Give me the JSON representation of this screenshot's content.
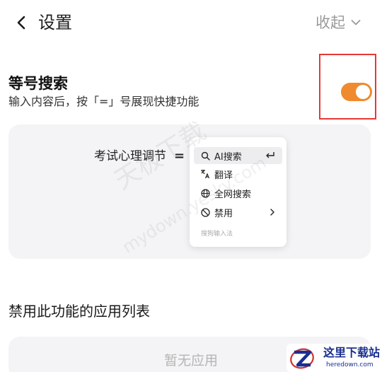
{
  "header": {
    "title": "设置",
    "collapse_label": "收起"
  },
  "feature": {
    "title": "等号搜索",
    "description": "输入内容后，按「=」号展现快捷功能",
    "toggle_on": true,
    "accent_color": "#f08a2e"
  },
  "preview": {
    "sample_text": "考试心理调节",
    "trigger_symbol": "=",
    "menu": [
      {
        "label": "AI搜索",
        "icon": "search-icon",
        "tail_icon": "enter-icon",
        "active": true
      },
      {
        "label": "翻译",
        "icon": "translate-icon"
      },
      {
        "label": "全网搜索",
        "icon": "globe-icon"
      },
      {
        "label": "禁用",
        "icon": "ban-icon",
        "tail_icon": "chevron-right-icon"
      }
    ],
    "footer": "搜狗输入法"
  },
  "disabled_apps": {
    "title": "禁用此功能的应用列表",
    "empty_text": "暂无应用"
  },
  "watermarks": {
    "primary": "天极下载",
    "secondary": "mydown.yesky.com"
  },
  "site_badge": {
    "name": "这里下载站",
    "url": "heredown.com"
  },
  "annotation": {
    "color": "#e53935"
  }
}
